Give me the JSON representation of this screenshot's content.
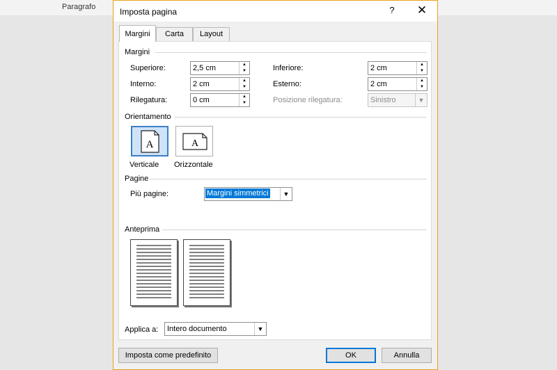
{
  "background": {
    "ribbon_label": "Paragrafo"
  },
  "dialog": {
    "title": "Imposta pagina",
    "help_label": "?",
    "close_label": "✕",
    "tabs": [
      {
        "label": "Margini",
        "active": true
      },
      {
        "label": "Carta",
        "active": false
      },
      {
        "label": "Layout",
        "active": false
      }
    ],
    "margins": {
      "section_title": "Margini",
      "top_label": "Superiore:",
      "top_value": "2,5 cm",
      "bottom_label": "Inferiore:",
      "bottom_value": "2 cm",
      "inner_label": "Interno:",
      "inner_value": "2 cm",
      "outer_label": "Esterno:",
      "outer_value": "2 cm",
      "gutter_label": "Rilegatura:",
      "gutter_value": "0 cm",
      "gutter_pos_label": "Posizione rilegatura:",
      "gutter_pos_value": "Sinistro"
    },
    "orientation": {
      "section_title": "Orientamento",
      "portrait_label": "Verticale",
      "landscape_label": "Orizzontale",
      "icon_glyph": "A",
      "selected": "portrait"
    },
    "pages": {
      "section_title": "Pagine",
      "multiple_label": "Più pagine:",
      "multiple_value": "Margini simmetrici"
    },
    "preview": {
      "section_title": "Anteprima"
    },
    "apply": {
      "label": "Applica a:",
      "value": "Intero documento"
    },
    "buttons": {
      "default_label": "Imposta come predefinito",
      "ok_label": "OK",
      "cancel_label": "Annulla"
    },
    "colors": {
      "accent": "#0078d7",
      "frame": "#e8a21a"
    }
  }
}
